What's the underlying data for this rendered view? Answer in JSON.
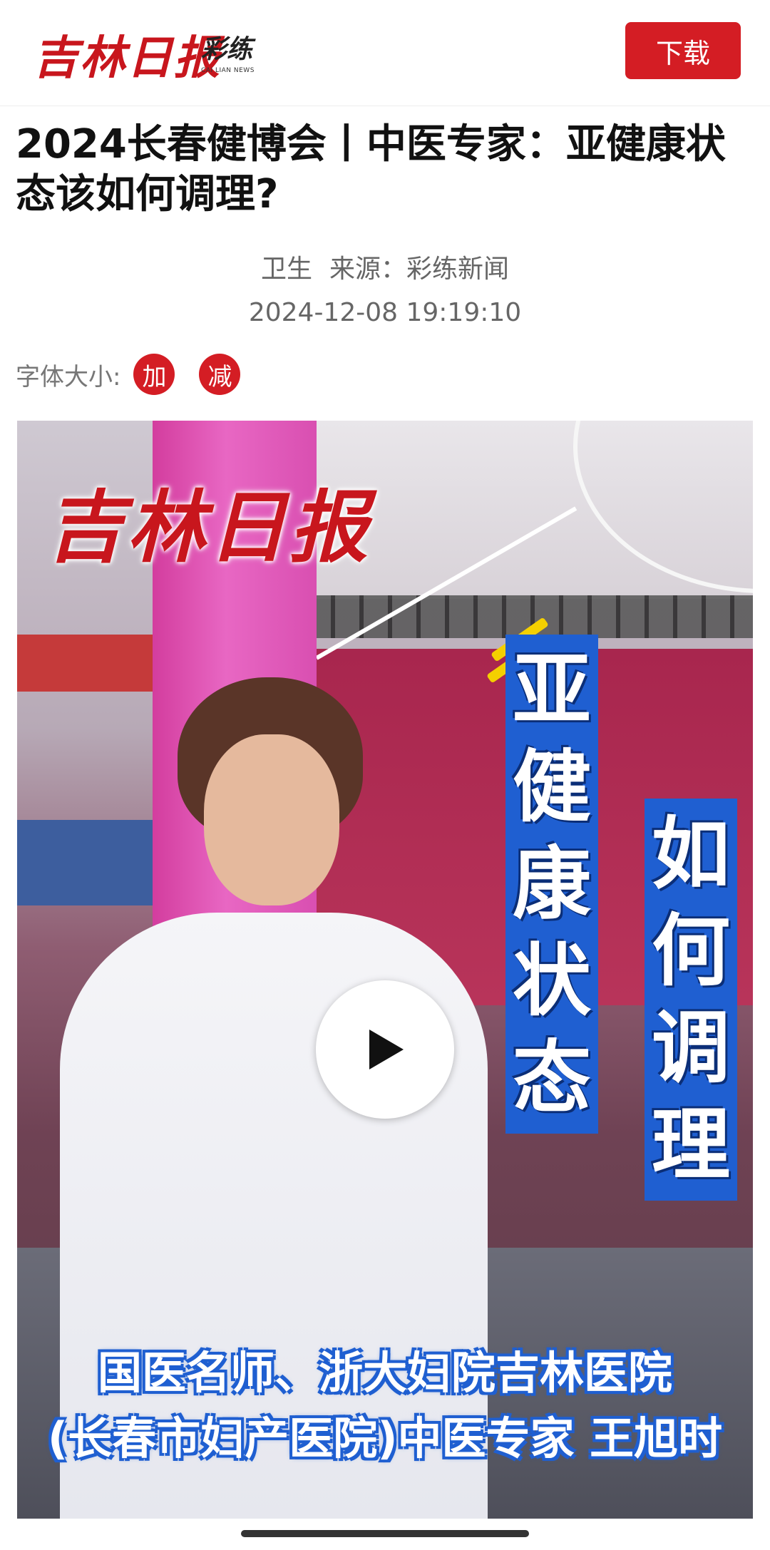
{
  "header": {
    "logo_text": "吉林日报",
    "partner_logo_text": "彩练",
    "partner_logo_sub": "CAI LIAN NEWS",
    "download_label": "下载"
  },
  "article": {
    "title": "2024长春健博会丨中医专家：亚健康状态该如何调理?",
    "category": "卫生",
    "source": "来源：彩练新闻",
    "datetime": "2024-12-08 19:19:10",
    "font_size_label": "字体大小:",
    "font_increase": "加",
    "font_decrease": "减"
  },
  "video": {
    "overlay_logo": "吉林日报",
    "vertical_title_1": [
      "亚",
      "健",
      "康",
      "状",
      "态"
    ],
    "vertical_title_2": [
      "如",
      "何",
      "调",
      "理"
    ],
    "caption_line1": "国医名师、浙大妇院吉林医院",
    "caption_line2": "(长春市妇产医院)中医专家 王旭时",
    "play_icon": "play-icon"
  },
  "colors": {
    "brand_red": "#d41d24",
    "caption_blue": "#1f5fd1"
  }
}
